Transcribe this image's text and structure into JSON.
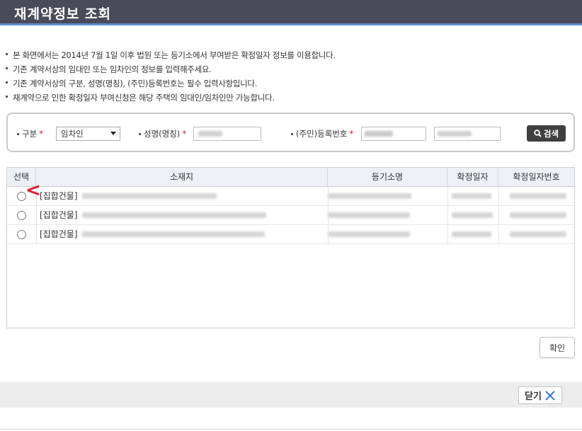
{
  "window": {
    "title": "재계약정보 조회"
  },
  "notes": [
    "본 화면에서는 2014년 7월 1일 이후 법원 또는 등기소에서 부여받은 확정일자 정보를 이용합니다.",
    "기존 계약서상의 임대인 또는 임차인의 정보를 입력해주세요.",
    "기존 계약서상의 구분, 성명(명칭), (주민)등록번호는 필수 입력사항입니다.",
    "재계약으로 인한 확정일자 부여신청은 해당 주택의 임대인/임차인만 가능합니다."
  ],
  "search": {
    "type_label": "구분",
    "type_value": "임차인",
    "name_label": "성명(명칭)",
    "regno_label": "(주민)등록번호",
    "required_mark": "*",
    "button_label": "검색"
  },
  "grid": {
    "columns": [
      "선택",
      "소재지",
      "등기소명",
      "확정일자",
      "확정일자번호"
    ],
    "rows": [
      {
        "address_prefix": "[집합건물]"
      },
      {
        "address_prefix": "[집합건물]"
      },
      {
        "address_prefix": "[집합건물]"
      }
    ]
  },
  "annotation": {
    "marker": "<",
    "color": "#e8192c"
  },
  "buttons": {
    "confirm": "확인",
    "close": "닫기"
  },
  "colors": {
    "titlebar": "#4a4a5a",
    "accent": "#5b8fd6",
    "search_button": "#3f3f3f"
  }
}
